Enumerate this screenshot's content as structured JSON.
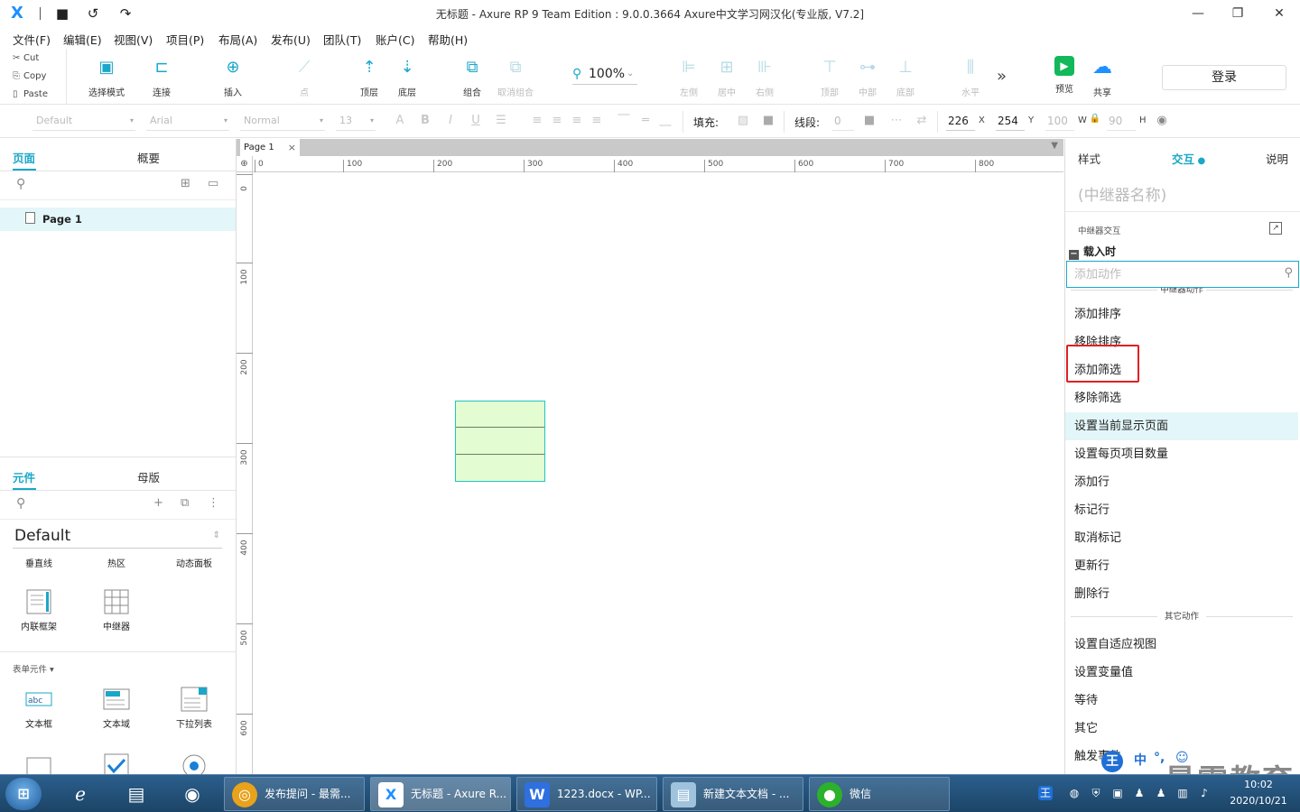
{
  "window": {
    "title": "无标题 - Axure RP 9 Team Edition : 9.0.0.3664 Axure中文学习网汉化(专业版, V7.2]",
    "min_label": "—",
    "max_label": "❐",
    "close_label": "✕"
  },
  "menu": [
    "文件(F)",
    "编辑(E)",
    "视图(V)",
    "项目(P)",
    "布局(A)",
    "发布(U)",
    "团队(T)",
    "账户(C)",
    "帮助(H)"
  ],
  "clipboard": {
    "cut": "Cut",
    "copy": "Copy",
    "paste": "Paste"
  },
  "toolbar": {
    "select_mode": "选择模式",
    "connect": "连接",
    "insert": "插入",
    "point": "点",
    "top": "顶层",
    "bottom": "底层",
    "group": "组合",
    "ungroup": "取消组合",
    "zoom": "100%",
    "align_left": "左侧",
    "align_center": "居中",
    "align_right": "右侧",
    "align_top": "顶部",
    "align_middle": "中部",
    "align_bottom": "底部",
    "distribute_h": "水平",
    "preview": "预览",
    "share": "共享",
    "login": "登录"
  },
  "format": {
    "style": "Default",
    "font": "Arial",
    "weight": "Normal",
    "size": "13",
    "fill_label": "填充:",
    "line_label": "线段:",
    "line_value": "0",
    "x": "226",
    "x_unit": "X",
    "y": "254",
    "y_unit": "Y",
    "w": "100",
    "w_unit": "W",
    "h": "90",
    "h_unit": "H"
  },
  "left": {
    "tabs": [
      "页面",
      "概要"
    ],
    "page_name": "Page 1",
    "lib_tabs": [
      "元件",
      "母版"
    ],
    "library": "Default",
    "row1": [
      "垂直线",
      "热区",
      "动态面板"
    ],
    "row2": [
      "内联框架",
      "中继器"
    ],
    "form_section": "表单元件 ▾",
    "row3": [
      "文本框",
      "文本域",
      "下拉列表"
    ]
  },
  "canvas": {
    "tab": "Page 1",
    "hticks": [
      "0",
      "100",
      "200",
      "300",
      "400",
      "500",
      "600",
      "700",
      "800"
    ],
    "vticks": [
      "0",
      "100",
      "200",
      "300",
      "400",
      "500",
      "600"
    ]
  },
  "right": {
    "tabs": [
      "样式",
      "交互",
      "说明"
    ],
    "repeater_name": "(中继器名称)",
    "repeater_interaction": "中继器交互",
    "on_load": "载入时",
    "add_action_placeholder": "添加动作",
    "partial_group": "中继器动作",
    "actions": [
      "添加排序",
      "移除排序",
      "添加筛选",
      "移除筛选",
      "设置当前显示页面",
      "设置每页项目数量",
      "添加行",
      "标记行",
      "取消标记",
      "更新行",
      "删除行"
    ],
    "other_group": "其它动作",
    "other_actions": [
      "设置自适应视图",
      "设置变量值",
      "等待",
      "其它",
      "触发事件"
    ]
  },
  "taskbar": {
    "tasks": [
      "发布提问 - 最需...",
      "无标题 - Axure R...",
      "1223.docx - WP...",
      "新建文本文档 - ...",
      "微信"
    ],
    "time": "10:02",
    "date": "2020/10/21"
  },
  "watermark": "最需教育",
  "ime": [
    "王",
    "中",
    "°,",
    "☺"
  ]
}
